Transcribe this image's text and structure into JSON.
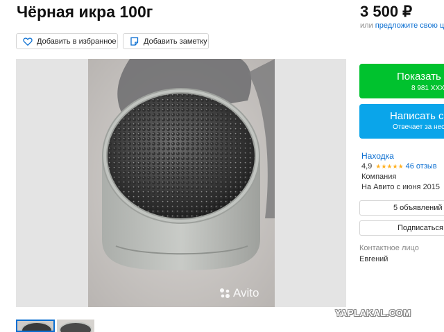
{
  "listing": {
    "title": "Чёрная икра 100г",
    "price": "3 500 ₽",
    "price_or": "или",
    "price_offer_link": "предложите свою це"
  },
  "actions": {
    "favorite_label": "Добавить в избранное",
    "note_label": "Добавить заметку"
  },
  "gallery": {
    "watermark": "Avito"
  },
  "contact_buttons": {
    "show_label": "Показать",
    "show_phone": "8 981 XXX",
    "write_label": "Написать с",
    "write_sub": "Отвечает за нес"
  },
  "seller": {
    "name": "Находка",
    "rating": "4,9",
    "stars": "★★★★★",
    "reviews": "46 отзыв",
    "type": "Компания",
    "since": "На Авито с июня 2015",
    "ads_button": "5 объявлений",
    "subscribe_button": "Подписаться н",
    "contact_label": "Контактное лицо",
    "contact_name": "Евгений"
  },
  "site_watermark": "YAPLAKAL.COM",
  "colors": {
    "green_button": "#00c22e",
    "blue_button": "#0aa5ea",
    "link": "#0a6ed1",
    "star": "#ffb021"
  }
}
